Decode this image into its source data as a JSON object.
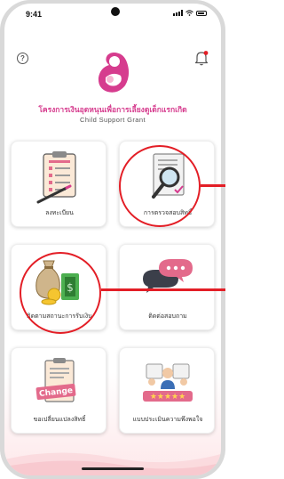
{
  "status_bar": {
    "time": "9:41"
  },
  "header": {
    "help_label": "?",
    "title_th": "โครงการเงินอุดหนุนเพื่อการเลี้ยงดูเด็กแรกเกิด",
    "title_en": "Child Support Grant"
  },
  "menu": {
    "items": [
      {
        "label": "ลงทะเบียน",
        "icon": "clipboard-register-icon"
      },
      {
        "label": "การตรวจสอบสิทธิ์",
        "icon": "document-search-icon"
      },
      {
        "label": "ติดตามสถานะการรับเงิน",
        "icon": "money-bag-icon"
      },
      {
        "label": "ติดต่อสอบถาม",
        "icon": "chat-bubbles-icon"
      },
      {
        "label": "ขอเปลี่ยนแปลงสิทธิ์",
        "icon": "change-request-icon"
      },
      {
        "label": "แบบประเมินความพึงพอใจ",
        "icon": "satisfaction-rating-icon"
      }
    ],
    "change_badge": "Change"
  },
  "colors": {
    "brand_pink": "#d63c8e",
    "highlight_red": "#e31e26"
  }
}
